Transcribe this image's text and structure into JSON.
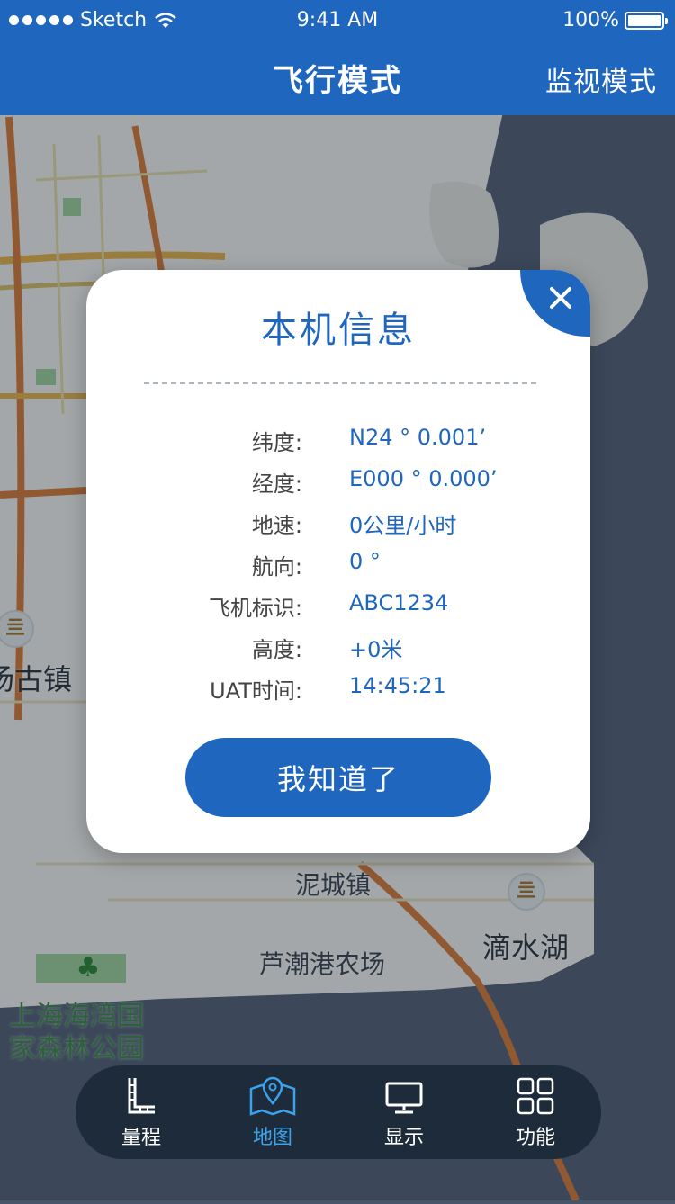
{
  "status_bar": {
    "carrier": "Sketch",
    "time": "9:41 AM",
    "battery": "100%"
  },
  "nav": {
    "title": "飞行模式",
    "right_label": "监视模式"
  },
  "map": {
    "labels": {
      "town_left": "汤古镇",
      "town_nicheng": "泥城镇",
      "lake": "滴水湖",
      "farm": "芦潮港农场",
      "park": "上海海湾国\n家森林公园"
    }
  },
  "modal": {
    "title": "本机信息",
    "rows": [
      {
        "label": "纬度:",
        "value": "N24 ° 0.001’"
      },
      {
        "label": "经度:",
        "value": "E000 ° 0.000’"
      },
      {
        "label": "地速:",
        "value": "0公里/小时"
      },
      {
        "label": "航向:",
        "value": "0 °"
      },
      {
        "label": "飞机标识:",
        "value": "ABC1234"
      },
      {
        "label": "高度:",
        "value": "+0米"
      },
      {
        "label": "UAT时间:",
        "value": "14:45:21"
      }
    ],
    "confirm_label": "我知道了"
  },
  "tabbar": {
    "items": [
      {
        "label": "量程",
        "icon": "ruler-icon",
        "active": false
      },
      {
        "label": "地图",
        "icon": "map-pin-icon",
        "active": true
      },
      {
        "label": "显示",
        "icon": "monitor-icon",
        "active": false
      },
      {
        "label": "功能",
        "icon": "grid-icon",
        "active": false
      }
    ]
  },
  "colors": {
    "primary": "#1f66bf",
    "tab_active": "#3aa3f0",
    "tabbar_bg": "#1e2b3a"
  }
}
